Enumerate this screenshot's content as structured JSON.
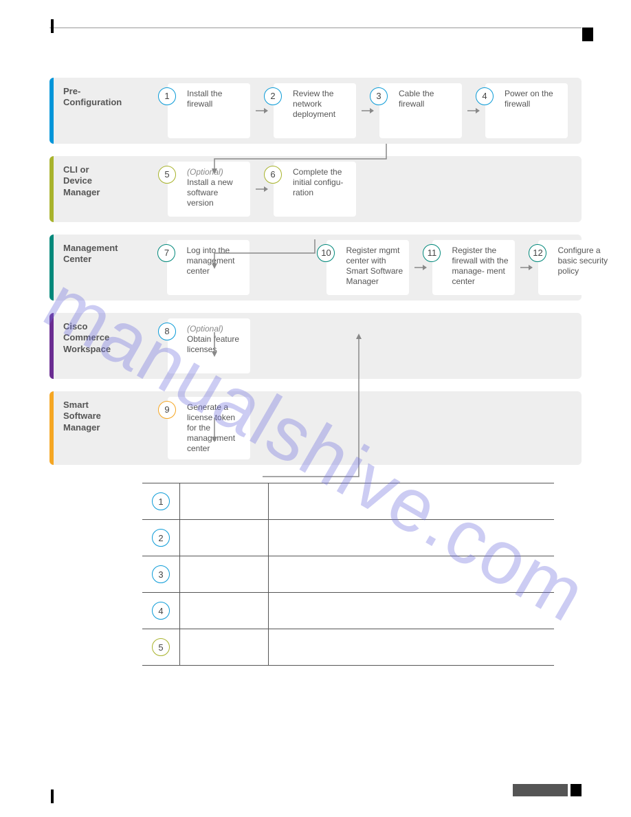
{
  "watermark": "manualshive.com",
  "stages": [
    {
      "label": "Pre-\nConfiguration",
      "color": "blue",
      "cards": [
        {
          "num": "1",
          "ring": "blue",
          "text": "Install the firewall"
        },
        {
          "num": "2",
          "ring": "blue",
          "text": "Review the network deployment"
        },
        {
          "num": "3",
          "ring": "blue",
          "text": "Cable the firewall"
        },
        {
          "num": "4",
          "ring": "blue",
          "text": "Power on the firewall"
        }
      ]
    },
    {
      "label": "CLI or Device Manager",
      "color": "olive",
      "cards": [
        {
          "num": "5",
          "ring": "olive",
          "optional": "(Optional)",
          "text": "Install a new software version"
        },
        {
          "num": "6",
          "ring": "olive",
          "text": "Complete the initial configu-\nration"
        }
      ]
    },
    {
      "label": "Management Center",
      "color": "teal",
      "cards": [
        {
          "num": "7",
          "ring": "teal",
          "text": "Log into the management center"
        },
        {
          "num": "10",
          "ring": "teal",
          "text": "Register mgmt center with Smart Software Manager"
        },
        {
          "num": "11",
          "ring": "teal",
          "text": "Register the firewall with the manage-\nment center"
        },
        {
          "num": "12",
          "ring": "teal",
          "text": "Configure a basic security policy"
        }
      ]
    },
    {
      "label": "Cisco Commerce Workspace",
      "color": "purple",
      "cards": [
        {
          "num": "8",
          "ring": "blue",
          "optional": "(Optional)",
          "text": "Obtain feature licenses"
        }
      ]
    },
    {
      "label": "Smart Software Manager",
      "color": "orange",
      "cards": [
        {
          "num": "9",
          "ring": "orange",
          "text": "Generate a license token for the management center"
        }
      ]
    }
  ],
  "table_rows": [
    {
      "num": "1",
      "ring": "blue"
    },
    {
      "num": "2",
      "ring": "blue"
    },
    {
      "num": "3",
      "ring": "blue"
    },
    {
      "num": "4",
      "ring": "blue"
    },
    {
      "num": "5",
      "ring": "olive"
    }
  ]
}
